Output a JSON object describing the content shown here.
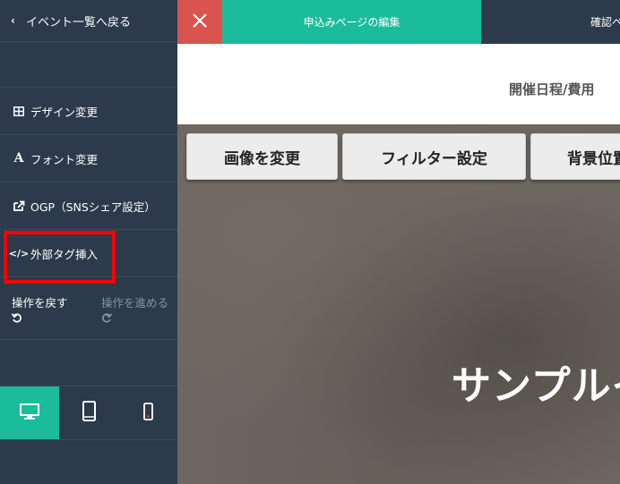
{
  "sidebar": {
    "back_label": "イベント一覧へ戻る",
    "items": [
      {
        "label": "デザイン変更",
        "icon": "grid-icon"
      },
      {
        "label": "フォント変更",
        "icon": "font-a-icon"
      },
      {
        "label": "OGP（SNSシェア設定）",
        "icon": "share-icon"
      },
      {
        "label": "外部タグ挿入",
        "icon": "code-icon"
      }
    ],
    "undo_label": "操作を戻す",
    "redo_label": "操作を進める",
    "devices": [
      "desktop-icon",
      "tablet-icon",
      "mobile-icon"
    ]
  },
  "topbar": {
    "tabs": [
      {
        "label": "申込みページの編集",
        "active": true
      },
      {
        "label": "確認ペ",
        "active": false
      }
    ]
  },
  "header": {
    "nav_title": "開催日程/費用"
  },
  "hero": {
    "buttons": [
      "画像を変更",
      "フィルター設定",
      "背景位置"
    ],
    "title": "サンプルイ"
  },
  "colors": {
    "sidebar_bg": "#2c3a4b",
    "accent": "#1abc9c",
    "close": "#d9534f",
    "highlight": "#ff0000"
  }
}
